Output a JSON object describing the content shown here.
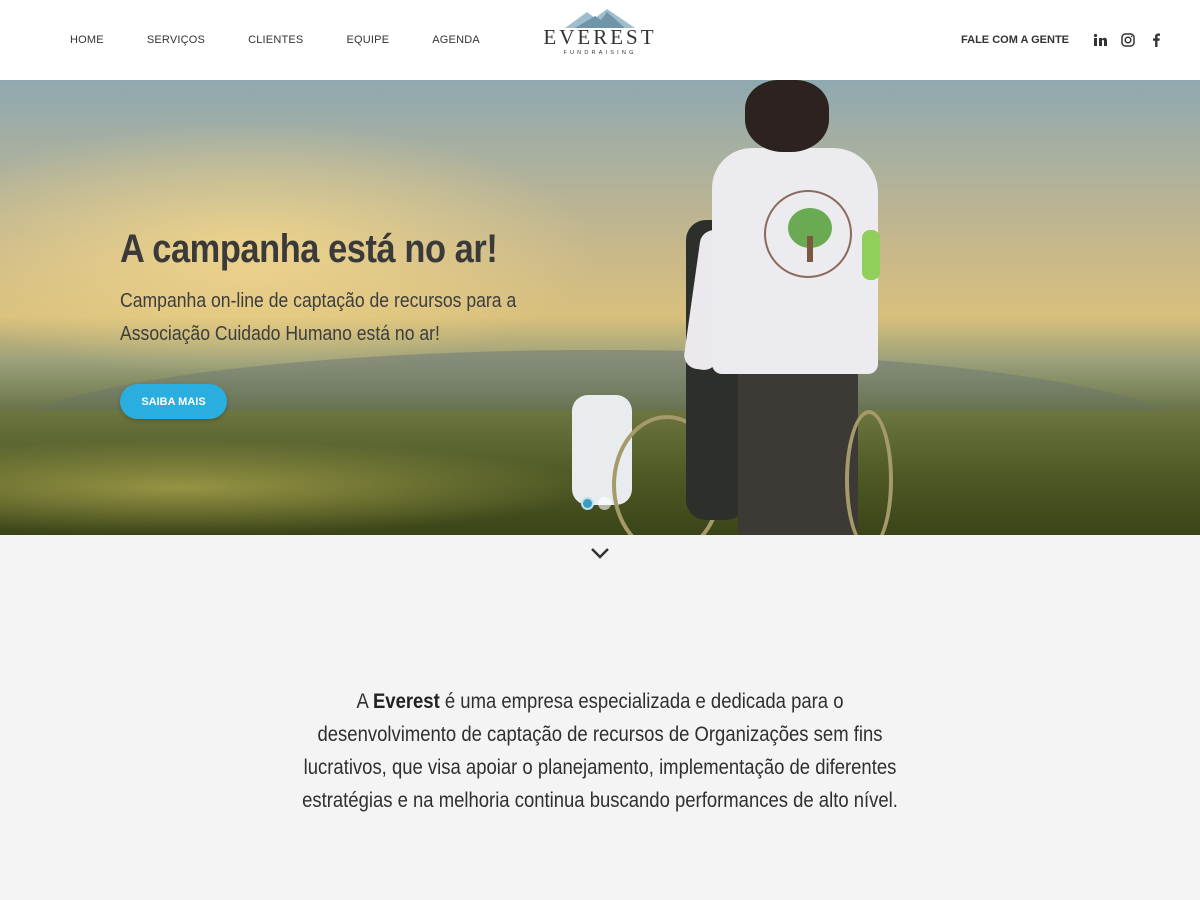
{
  "nav": {
    "items": [
      "HOME",
      "SERVIÇOS",
      "CLIENTES",
      "EQUIPE",
      "AGENDA"
    ],
    "contact": "FALE COM A GENTE"
  },
  "logo": {
    "word": "EVEREST",
    "sub": "FUNDRAISING"
  },
  "social": [
    "linkedin-icon",
    "instagram-icon",
    "facebook-icon"
  ],
  "hero": {
    "title": "A campanha está no ar!",
    "subtitle": "Campanha on-line de captação de recursos para a Associação Cuidado Humano está no ar!",
    "button": "SAIBA MAIS",
    "slides": 2,
    "active_slide": 1
  },
  "colors": {
    "accent": "#2aaee0",
    "text": "#333333",
    "background": "#f4f4f4"
  },
  "about": {
    "prefix": "A ",
    "brand": "Everest",
    "text": " é uma empresa especializada e dedicada para o desenvolvimento de captação de recursos de Organizações sem fins lucrativos, que visa apoiar o planejamento, implementação de diferentes estratégias e na melhoria continua buscando performances de alto nível."
  }
}
